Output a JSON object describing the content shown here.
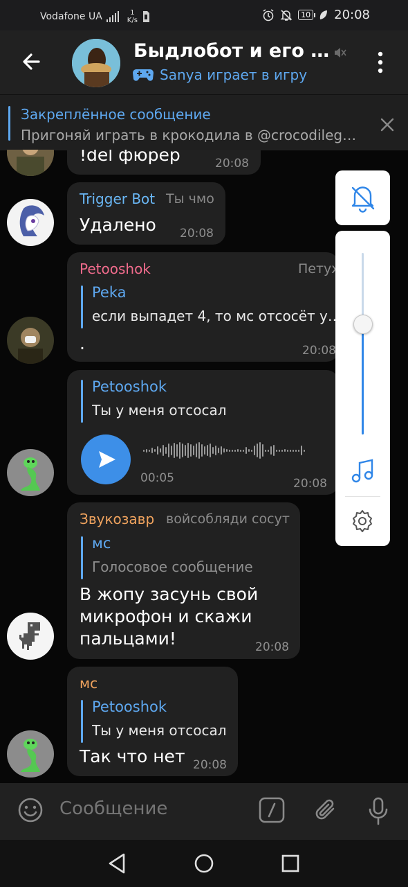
{
  "status_bar": {
    "carrier": "Vodafone UA",
    "speed_value": "1",
    "speed_unit": "K/s",
    "battery": "10",
    "time": "20:08"
  },
  "header": {
    "title": "Быдлобот и его др…",
    "status": "Sanya играет в игру"
  },
  "pinned": {
    "title": "Закреплённое сообщение",
    "text": "Пригоняй играть в крокодила в @crocodileg…"
  },
  "messages": [
    {
      "text": "!del фюрер",
      "time": "20:08"
    },
    {
      "sender": "Trigger Bot",
      "tag": "Ты чмо",
      "text": "Удалено",
      "time": "20:08",
      "sender_color": "#6ab7f5"
    },
    {
      "sender": "Petooshok",
      "tag": "Петух",
      "reply_name": "Peka",
      "reply_text": "если выпадет 4, то мс отсосёт у…",
      "text": ".",
      "time": "20:08",
      "sender_color": "#f06b8c"
    },
    {
      "reply_name": "Petooshok",
      "reply_text": "Ты у меня отсосал",
      "duration": "00:05",
      "time": "20:08"
    },
    {
      "sender": "Звукозавр",
      "tag": "войсобляди сосут",
      "reply_name": "мс",
      "reply_text": "Голосовое сообщение",
      "text_line1": "В жопу засунь свой",
      "text_line2": "микрофон и скажи",
      "text_line3": "пальцами!",
      "time": "20:08",
      "sender_color": "#f0a35e"
    },
    {
      "sender": "мс",
      "reply_name": "Petooshok",
      "reply_text": "Ты у меня отсосал",
      "text": "Так что нет",
      "time": "20:08",
      "sender_color": "#f0a35e"
    }
  ],
  "side_panel": {
    "volume_level": 0.61
  },
  "input": {
    "placeholder": "Сообщение"
  },
  "colors": {
    "accent": "#5ea8f0",
    "bubble": "#212121",
    "play_button": "#3d8fe8"
  }
}
